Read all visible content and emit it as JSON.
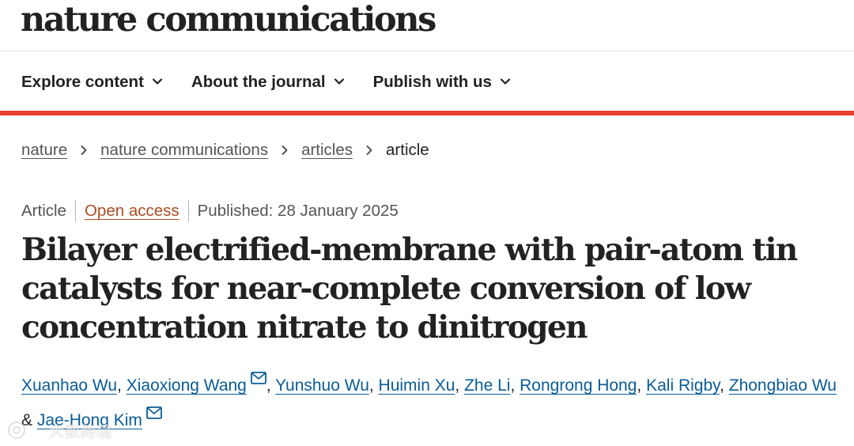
{
  "header": {
    "brand": "nature communications"
  },
  "nav": {
    "items": [
      {
        "label": "Explore content"
      },
      {
        "label": "About the journal"
      },
      {
        "label": "Publish with us"
      }
    ]
  },
  "colors": {
    "accent_bar": "#e8402c",
    "author_link": "#0a5c98",
    "open_access": "#b04a23"
  },
  "breadcrumb": {
    "items": [
      {
        "label": "nature"
      },
      {
        "label": "nature communications"
      },
      {
        "label": "articles"
      }
    ],
    "current": "article"
  },
  "article": {
    "type": "Article",
    "access": "Open access",
    "published": "Published: 28 January 2025",
    "title": "Bilayer electrified-membrane with pair-atom tin catalysts for near-complete conversion of low concentration nitrate to dinitrogen",
    "authors": [
      "Xuanhao Wu",
      "Xiaoxiong Wang",
      "Yunshuo Wu",
      "Huimin Xu",
      "Zhe Li",
      "Rongrong Hong",
      "Kali Rigby",
      "Zhongbiao Wu",
      "Jae-Hong Kim"
    ],
    "comma": ", ",
    "and": " & "
  },
  "watermark": {
    "text": "大数跨境"
  },
  "icons": {
    "chevron": "chevron-down-icon",
    "breadcrumb_sep": "chevron-right-icon",
    "mail": "mail-icon"
  }
}
